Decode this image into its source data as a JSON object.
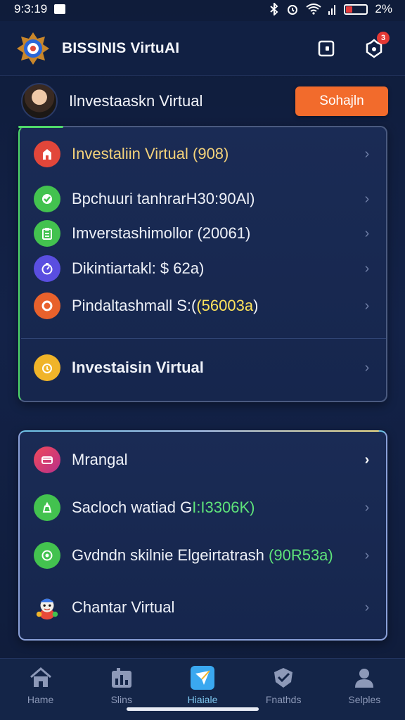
{
  "status_bar": {
    "time": "9:3:19",
    "battery": "2%"
  },
  "header": {
    "title": "BISSINIS VirtuAI",
    "notification_count": "3"
  },
  "profile": {
    "name": "Ilnvestaaskn Virtual",
    "button_label": "Sohajln"
  },
  "card1": {
    "items": [
      {
        "pre": "Investaliin Virtual (908)",
        "hl": "",
        "post": "",
        "icon": "house-icon",
        "color": "#e2463a",
        "hl_class": ""
      },
      {
        "pre": "Bpchuuri tanhrarH30:90Al)",
        "hl": "",
        "post": "",
        "icon": "check-icon",
        "color": "#43c24f",
        "hl_class": ""
      },
      {
        "pre": "Imverstashimollor (20061)",
        "hl": "",
        "post": "",
        "icon": "clipboard-icon",
        "color": "#43c24f",
        "hl_class": ""
      },
      {
        "pre": "Dikintiartakl: $ 62a)",
        "hl": "",
        "post": "",
        "icon": "gauge-icon",
        "color": "#5a4ee0",
        "hl_class": ""
      },
      {
        "pre": "Pindaltashmall S:(",
        "hl": "(56003a",
        "post": ")",
        "icon": "ring-icon",
        "color": "#e8612c",
        "hl_class": "hl-yellow"
      }
    ],
    "footer_item": {
      "label": "Investaisin Virtual",
      "icon": "coin-icon",
      "color": "#f0b429"
    }
  },
  "card2": {
    "items": [
      {
        "pre": "Mrangal",
        "hl": "",
        "post": "",
        "icon": "wallet-icon",
        "color": "#e0366b",
        "hl_class": ""
      },
      {
        "pre": "Sacloch watiad G",
        "hl": "I:I3306K)",
        "post": "",
        "icon": "bag-icon",
        "color": "#43c24f",
        "hl_class": "hl-green"
      },
      {
        "pre": "Gvdndn skilnie Elgeirtatrash ",
        "hl": "(90R53a)",
        "post": "",
        "icon": "target-icon",
        "color": "#43c24f",
        "hl_class": "hl-green"
      },
      {
        "pre": "Chantar Virtual",
        "hl": "",
        "post": "",
        "icon": "mascot-icon",
        "color": "",
        "hl_class": ""
      }
    ]
  },
  "bottom_nav": {
    "items": [
      {
        "label": "Hame",
        "icon": "home-icon"
      },
      {
        "label": "Slins",
        "icon": "chart-icon"
      },
      {
        "label": "Hiaiale",
        "icon": "plane-icon"
      },
      {
        "label": "Fnathds",
        "icon": "shield-check-icon"
      },
      {
        "label": "Selples",
        "icon": "person-icon"
      }
    ]
  },
  "colors": {
    "accent": "#f26b2c",
    "card_border_green": "#4fd96a",
    "highlight_yellow": "#ffe45c",
    "highlight_green": "#5ee37a"
  }
}
